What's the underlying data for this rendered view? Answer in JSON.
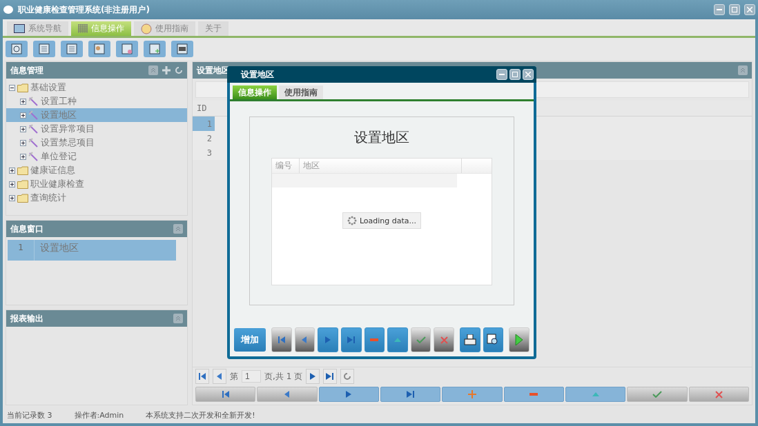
{
  "window": {
    "title": "职业健康检查管理系统(非注册用户)"
  },
  "tabs": [
    {
      "label": "系统导航",
      "selected": false,
      "kind": "monitor"
    },
    {
      "label": "信息操作",
      "selected": true,
      "kind": "grid"
    },
    {
      "label": "使用指南",
      "selected": false,
      "kind": "clock"
    },
    {
      "label": "关于",
      "selected": false,
      "kind": "plain"
    }
  ],
  "toolbar": [
    {
      "kind": "search"
    },
    {
      "kind": "list"
    },
    {
      "kind": "document"
    },
    {
      "kind": "user"
    },
    {
      "kind": "screen"
    },
    {
      "kind": "add"
    },
    {
      "kind": "card"
    }
  ],
  "sidebar": {
    "title": "信息管理",
    "tree": [
      {
        "label": "基础设置",
        "kind": "folder",
        "expanded": true,
        "selected": false,
        "children": [
          {
            "label": "设置工种",
            "kind": "tool",
            "expanded": false,
            "selected": false
          },
          {
            "label": "设置地区",
            "kind": "tool",
            "expanded": false,
            "selected": true
          },
          {
            "label": "设置异常项目",
            "kind": "tool",
            "expanded": false,
            "selected": false
          },
          {
            "label": "设置禁忌项目",
            "kind": "tool",
            "expanded": false,
            "selected": false
          },
          {
            "label": "单位登记",
            "kind": "tool",
            "expanded": false,
            "selected": false
          }
        ]
      },
      {
        "label": "健康证信息",
        "kind": "folder",
        "expanded": false,
        "selected": false
      },
      {
        "label": "职业健康检查",
        "kind": "folder",
        "expanded": false,
        "selected": false
      },
      {
        "label": "查询统计",
        "kind": "folder",
        "expanded": false,
        "selected": false
      }
    ]
  },
  "info_window": {
    "title": "信息窗口",
    "rows": [
      {
        "number": "1",
        "label": "设置地区",
        "selected": true
      }
    ]
  },
  "report_output": {
    "title": "报表输出"
  },
  "main_panel": {
    "title": "设置地区",
    "grid": {
      "columns": [
        "ID"
      ],
      "rows": [
        {
          "id": "1",
          "selected": true
        },
        {
          "id": "2",
          "selected": false
        },
        {
          "id": "3",
          "selected": false
        }
      ]
    },
    "pager": {
      "page_label": "第",
      "page": "1",
      "total_label": "页,共 1 页"
    },
    "nav_buttons": [
      {
        "kind": "first",
        "enabled": false
      },
      {
        "kind": "prev",
        "enabled": false
      },
      {
        "kind": "next",
        "enabled": true
      },
      {
        "kind": "last",
        "enabled": true
      },
      {
        "kind": "plus",
        "enabled": true
      },
      {
        "kind": "minus",
        "enabled": true
      },
      {
        "kind": "up",
        "enabled": true
      },
      {
        "kind": "check",
        "enabled": false
      },
      {
        "kind": "cross",
        "enabled": false
      }
    ]
  },
  "dialog": {
    "title": "设置地区",
    "tabs": [
      {
        "label": "信息操作",
        "selected": true
      },
      {
        "label": "使用指南",
        "selected": false
      }
    ],
    "heading": "设置地区",
    "grid": {
      "columns": [
        "编号",
        "地区"
      ]
    },
    "loading": "Loading data...",
    "add_button": "增加",
    "buttons": [
      {
        "kind": "first",
        "enabled": false
      },
      {
        "kind": "prev",
        "enabled": false
      },
      {
        "kind": "next",
        "enabled": true
      },
      {
        "kind": "last",
        "enabled": true
      },
      {
        "kind": "minus",
        "enabled": true
      },
      {
        "kind": "up",
        "enabled": true
      },
      {
        "kind": "check",
        "enabled": false
      },
      {
        "kind": "cross",
        "enabled": false
      },
      {
        "kind": "print",
        "enabled": true
      },
      {
        "kind": "preview",
        "enabled": true
      },
      {
        "kind": "run",
        "enabled": false
      }
    ]
  },
  "status_bar": [
    "当前记录数 3",
    "操作者:Admin",
    "本系统支持二次开发和全新开发!"
  ]
}
